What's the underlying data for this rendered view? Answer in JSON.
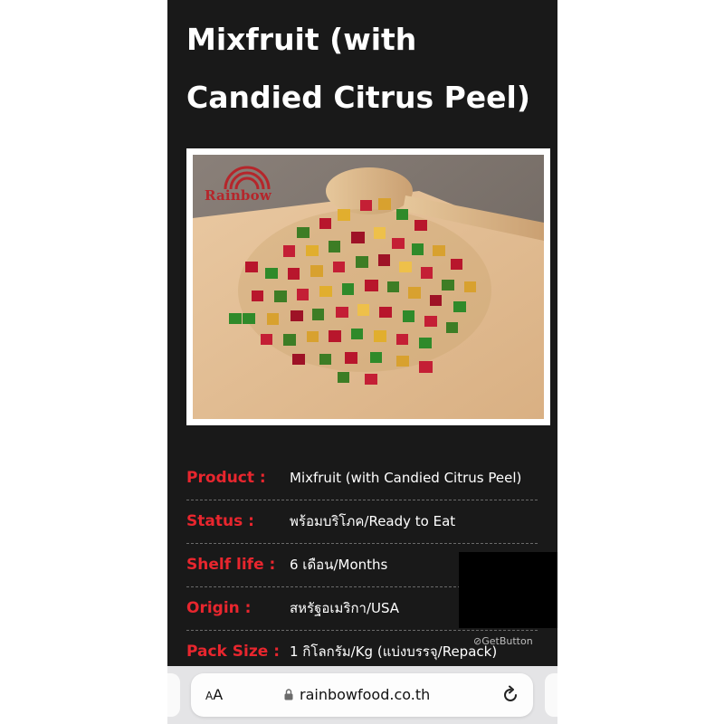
{
  "page": {
    "title_line1": "Mixfruit  (with",
    "title_line2": "Candied  Citrus  Peel)"
  },
  "image": {
    "brand_text": "Rainbow"
  },
  "details": [
    {
      "label": "Product :",
      "value": "Mixfruit (with Candied Citrus Peel)"
    },
    {
      "label": "Status :",
      "value": "พร้อมบริโภค/Ready to Eat"
    },
    {
      "label": "Shelf life :",
      "value": "6 เดือน/Months"
    },
    {
      "label": "Origin :",
      "value": "สหรัฐอเมริกา/USA"
    },
    {
      "label": "Pack Size :",
      "value": "1 กิโลกรัม/Kg (แบ่งบรรจุ/Repack)"
    }
  ],
  "widget": {
    "label": "GetButton",
    "icon": "getbutton-icon"
  },
  "browser": {
    "text_size_button": "AA",
    "url": "rainbowfood.co.th",
    "lock_icon": "lock-icon",
    "reload_icon": "reload-icon"
  },
  "colors": {
    "background": "#191919",
    "label_red": "#e8262e",
    "brand_red": "#b5262b"
  }
}
